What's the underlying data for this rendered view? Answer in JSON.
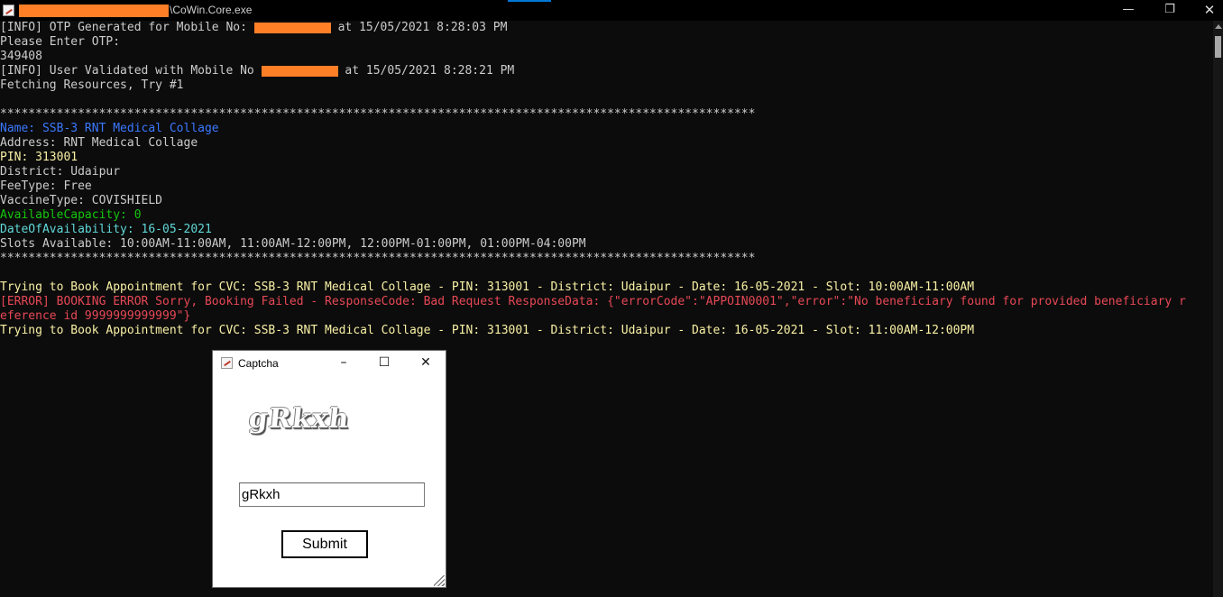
{
  "window": {
    "title": "\\CoWin.Core.exe",
    "icon": "console-app-icon",
    "buttons": [
      "minimize",
      "restore",
      "close"
    ]
  },
  "console": {
    "lines": [
      [
        {
          "t": "[INFO] OTP Generated for Mobile No: ",
          "c": "white"
        },
        {
          "redact": true
        },
        {
          "t": " at 15/05/2021 8:28:03 PM",
          "c": "white"
        }
      ],
      [
        {
          "t": "Please Enter OTP:",
          "c": "white"
        }
      ],
      [
        {
          "t": "349408",
          "c": "white"
        }
      ],
      [
        {
          "t": "[INFO] User Validated with Mobile No ",
          "c": "white"
        },
        {
          "redact": true
        },
        {
          "t": " at 15/05/2021 8:28:21 PM",
          "c": "white"
        }
      ],
      [
        {
          "t": "Fetching Resources, Try #1",
          "c": "white"
        }
      ],
      [
        {
          "t": "",
          "c": "white"
        }
      ],
      [
        {
          "t": "***********************************************************************************************************",
          "c": "white"
        }
      ],
      [
        {
          "t": "Name: SSB-3 RNT Medical Collage",
          "c": "blue"
        }
      ],
      [
        {
          "t": "Address: RNT Medical Collage",
          "c": "white"
        }
      ],
      [
        {
          "t": "PIN: 313001",
          "c": "yellow"
        }
      ],
      [
        {
          "t": "District: Udaipur",
          "c": "white"
        }
      ],
      [
        {
          "t": "FeeType: Free",
          "c": "white"
        }
      ],
      [
        {
          "t": "VaccineType: COVISHIELD",
          "c": "white"
        }
      ],
      [
        {
          "t": "AvailableCapacity: 0",
          "c": "green"
        }
      ],
      [
        {
          "t": "DateOfAvailability: 16-05-2021",
          "c": "cyan"
        }
      ],
      [
        {
          "t": "Slots Available: 10:00AM-11:00AM, 11:00AM-12:00PM, 12:00PM-01:00PM, 01:00PM-04:00PM",
          "c": "white"
        }
      ],
      [
        {
          "t": "***********************************************************************************************************",
          "c": "white"
        }
      ],
      [
        {
          "t": "",
          "c": "white"
        }
      ],
      [
        {
          "t": "Trying to Book Appointment for CVC: SSB-3 RNT Medical Collage - PIN: 313001 - District: Udaipur - Date: 16-05-2021 - Slot: 10:00AM-11:00AM",
          "c": "yellow"
        }
      ],
      [
        {
          "t": "[ERROR] BOOKING ERROR Sorry, Booking Failed - ResponseCode: Bad Request ResponseData: {\"errorCode\":\"APPOIN0001\",\"error\":\"No beneficiary found for provided beneficiary r",
          "c": "red"
        }
      ],
      [
        {
          "t": "eference id 9999999999999\"}",
          "c": "red"
        }
      ],
      [
        {
          "t": "Trying to Book Appointment for CVC: SSB-3 RNT Medical Collage - PIN: 313001 - District: Udaipur - Date: 16-05-2021 - Slot: 11:00AM-12:00PM",
          "c": "yellow"
        }
      ]
    ]
  },
  "colors": {
    "white": "#cccccc",
    "blue": "#3b78ff",
    "yellow": "#f9f1a5",
    "green": "#16c60c",
    "cyan": "#61d6d6",
    "red": "#e74856",
    "redaction": "#ff7f27"
  },
  "captcha_dialog": {
    "title": "Captcha",
    "captcha_text": "gRkxh",
    "input_value": "gRkxh",
    "submit_label": "Submit",
    "buttons": [
      "minimize",
      "maximize",
      "close"
    ]
  }
}
